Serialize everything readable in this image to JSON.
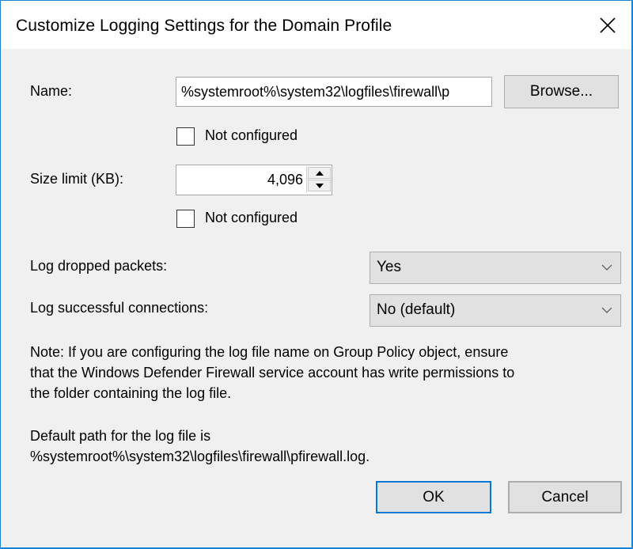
{
  "window": {
    "title": "Customize Logging Settings for the Domain Profile",
    "close_icon": "close-icon",
    "accent_color": "#1883d7"
  },
  "name_field": {
    "label": "Name:",
    "value": "%systemroot%\\system32\\logfiles\\firewall\\p",
    "browse_label": "Browse...",
    "not_configured_label": "Not configured",
    "not_configured_checked": false
  },
  "size_limit": {
    "label": "Size limit (KB):",
    "value": "4,096",
    "not_configured_label": "Not configured",
    "not_configured_checked": false
  },
  "log_dropped": {
    "label": "Log dropped packets:",
    "selected": "Yes"
  },
  "log_successful": {
    "label": "Log successful connections:",
    "selected": "No (default)"
  },
  "note": {
    "line1": "Note: If you are configuring the log file name on Group Policy object, ensure",
    "line2": "that the Windows Defender Firewall service account has write permissions to",
    "line3": "the folder containing the log file.",
    "default_line1": "Default path for the log file is",
    "default_line2": "%systemroot%\\system32\\logfiles\\firewall\\pfirewall.log."
  },
  "buttons": {
    "ok_label": "OK",
    "cancel_label": "Cancel"
  }
}
